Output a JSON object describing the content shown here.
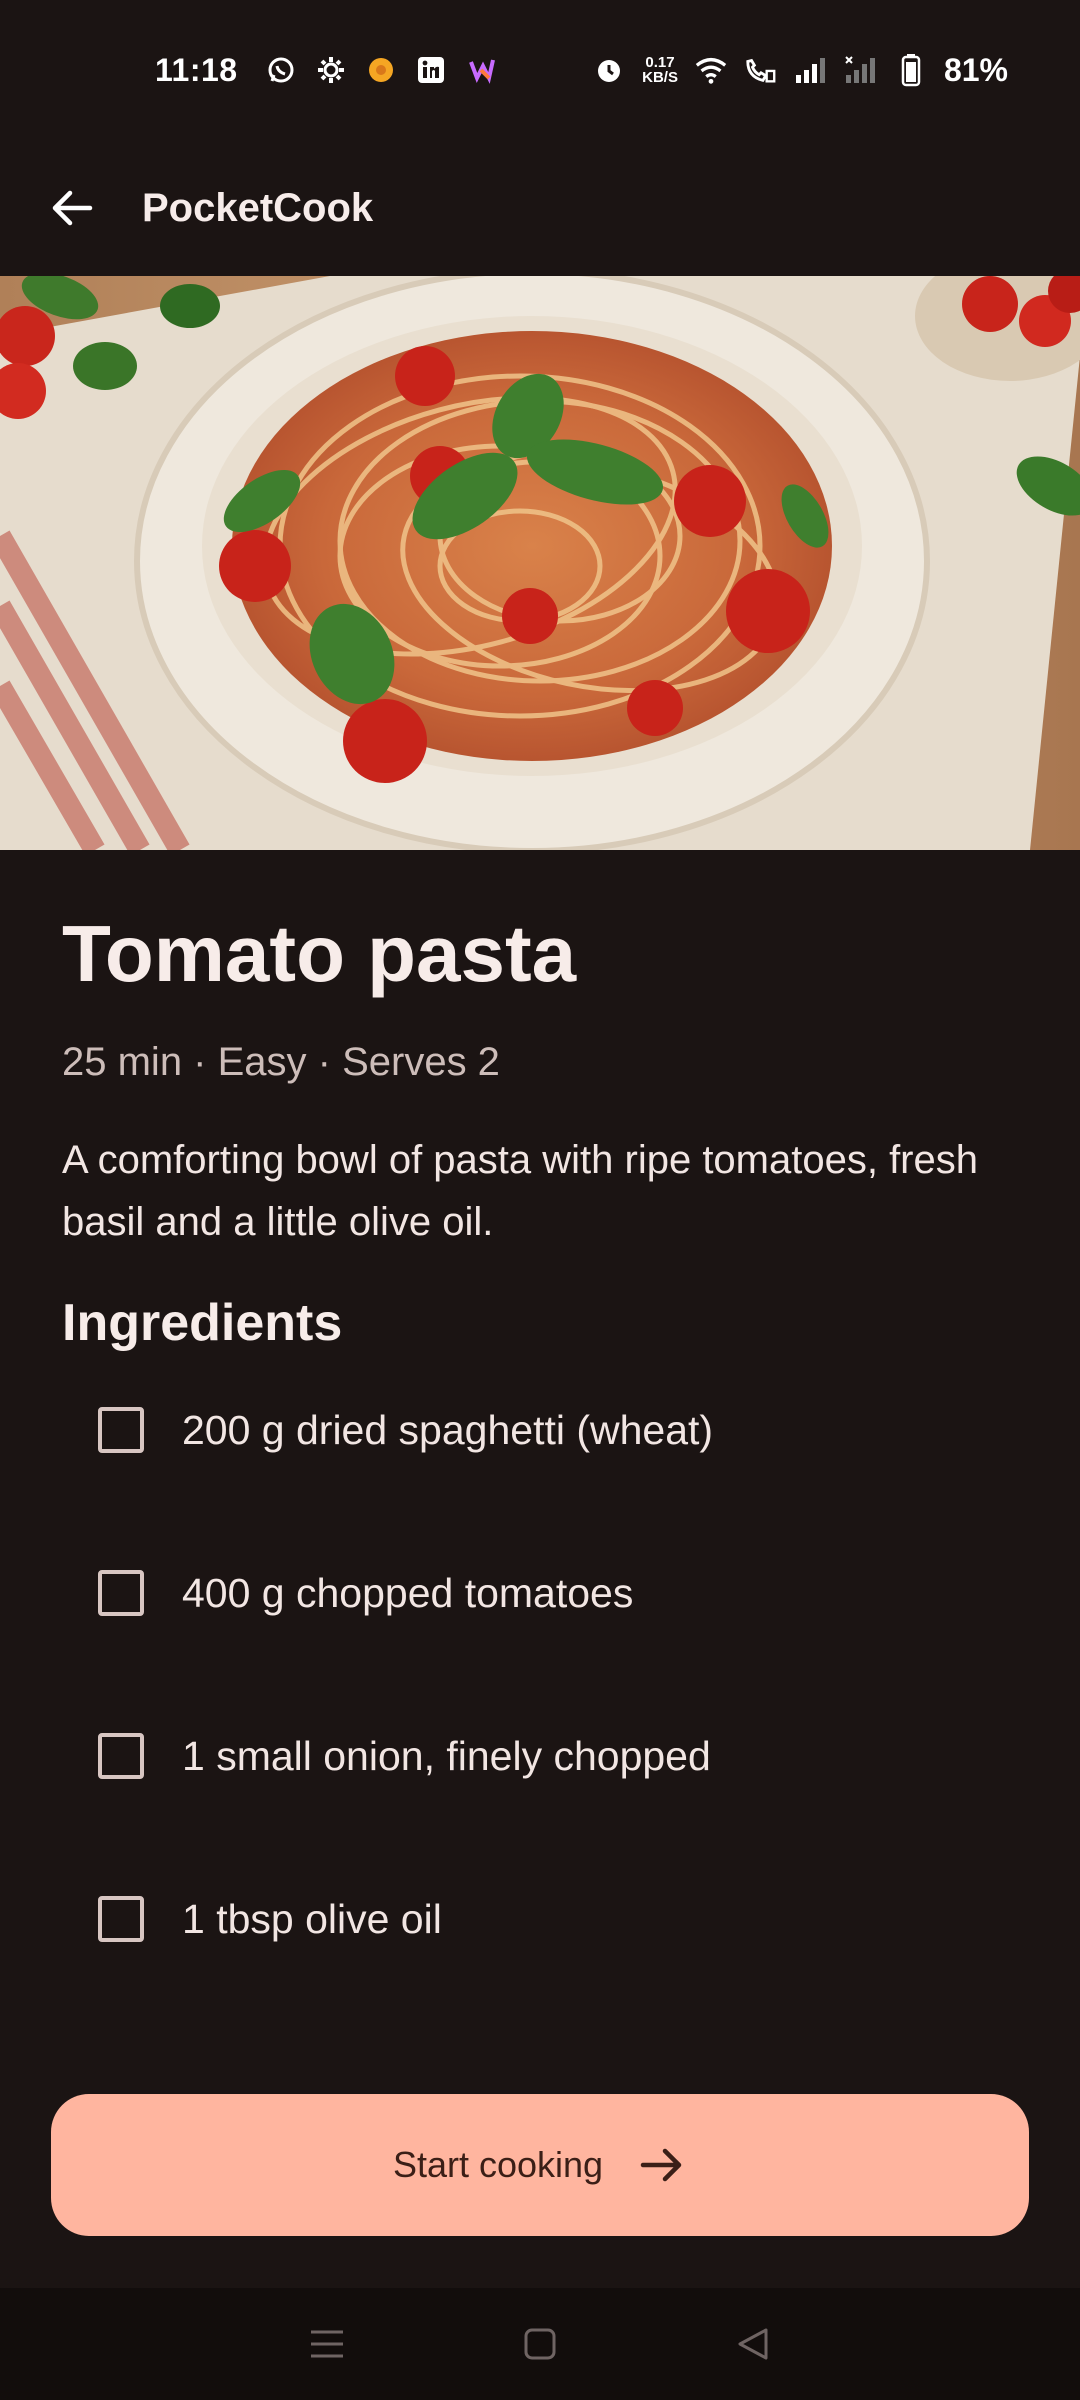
{
  "status_bar": {
    "time": "11:18",
    "speed_value": "0.17",
    "speed_unit": "KB/S",
    "battery_percent": "81%",
    "icons": [
      "whatsapp-icon",
      "settings-icon",
      "app-icon",
      "linkedin-icon",
      "app-icon",
      "alarm-icon",
      "wifi-icon",
      "wifi-call-icon",
      "signal-icon",
      "signal-icon",
      "battery-icon"
    ]
  },
  "app_bar": {
    "title": "PocketCook",
    "back_icon": "arrow-back-icon"
  },
  "recipe": {
    "title": "Tomato pasta",
    "meta": "25 min · Easy · Serves 2",
    "description": "A comforting bowl of pasta with ripe tomatoes, fresh basil and a little olive oil.",
    "ingredients_heading": "Ingredients",
    "ingredients": [
      {
        "label": "200 g dried spaghetti (wheat)",
        "checked": false
      },
      {
        "label": "400 g chopped tomatoes",
        "checked": false
      },
      {
        "label": "1 small onion, finely chopped",
        "checked": false
      },
      {
        "label": "1 tbsp olive oil",
        "checked": false
      }
    ]
  },
  "cta": {
    "label": "Start cooking",
    "icon": "arrow-forward-icon"
  },
  "colors": {
    "background": "#1b1413",
    "accent": "#ffb59f",
    "on_accent": "#3b1f17",
    "text_primary": "#f7ece9",
    "text_secondary": "#cdbdb9"
  },
  "nav_bar": {
    "icons": [
      "menu-icon",
      "home-icon",
      "back-icon"
    ]
  }
}
